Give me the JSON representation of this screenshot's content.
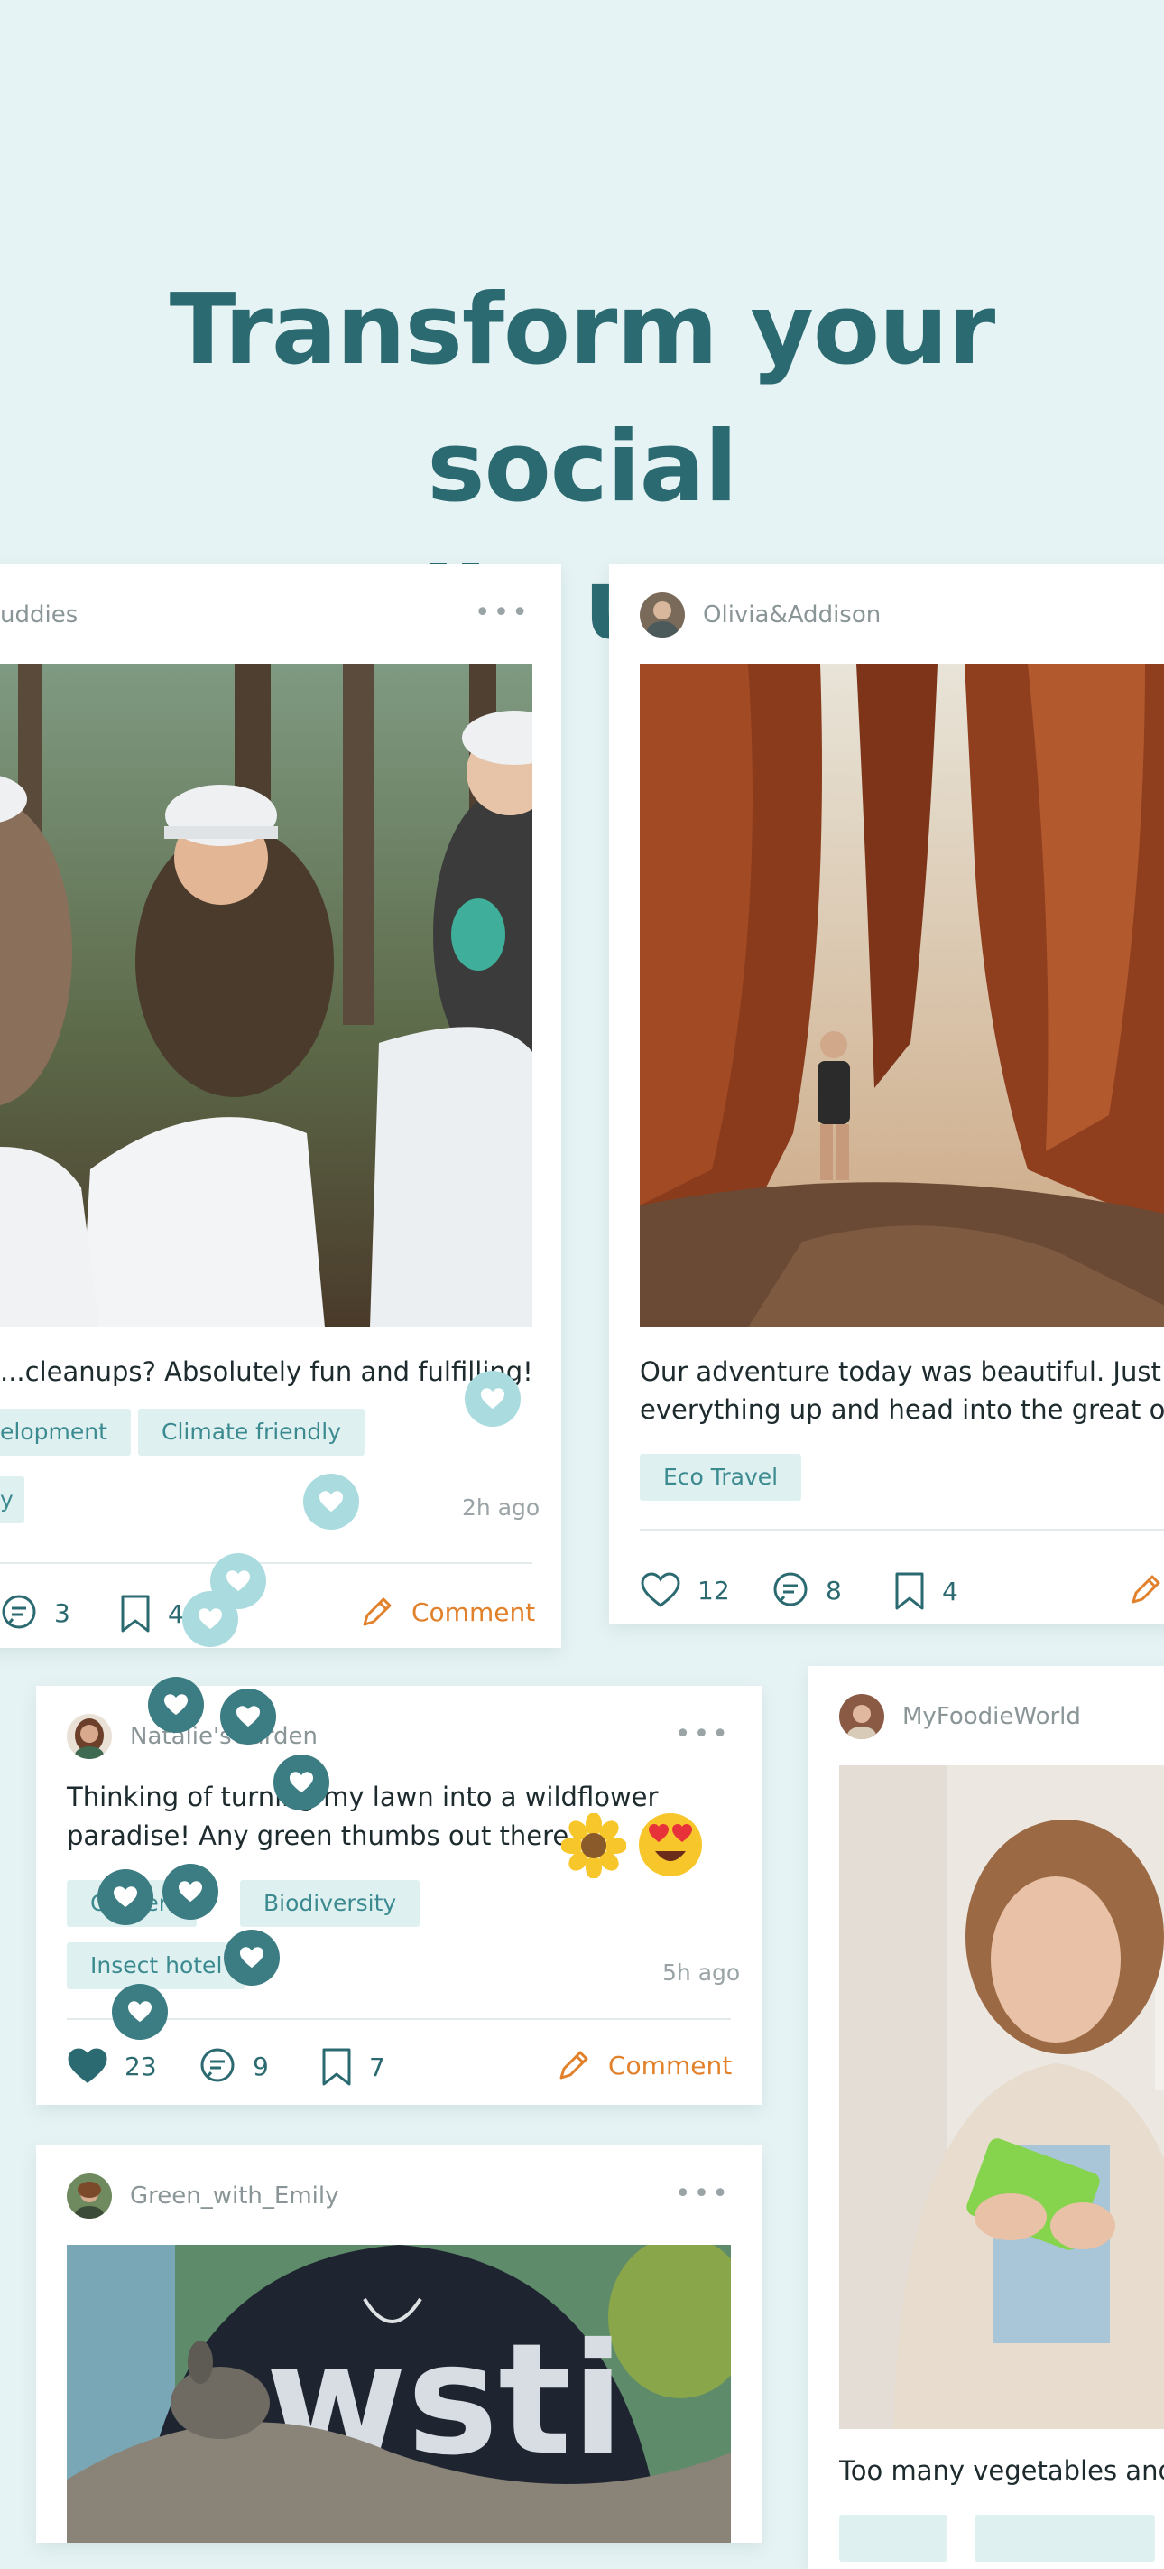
{
  "headline": {
    "line1": "Transform your social",
    "line2": "media usage."
  },
  "colors": {
    "teal": "#2b6a70",
    "accent": "#e2812b",
    "tag_bg": "#dff0f1",
    "background": "#e6f3f4"
  },
  "posts": {
    "cleanup": {
      "username": "uddies",
      "caption": "...cleanups? Absolutely fun and fulfilling!",
      "tags": [
        "elopment",
        "Climate friendly",
        "y"
      ],
      "time": "2h ago",
      "comments": "3",
      "saves": "4",
      "comment_label": "Comment",
      "image": "volunteers-cleanup-photo"
    },
    "adventure": {
      "username": "Olivia&Addison",
      "caption_line1": "Our adventure today was beautiful. Just pa",
      "caption_line2": "everything up and head into the great outd",
      "tags": [
        "Eco Travel"
      ],
      "likes": "12",
      "comments": "8",
      "saves": "4",
      "image": "redwood-forest-hiker-photo"
    },
    "wildflower": {
      "username": "Natalie'sGarden",
      "caption_line1": "Thinking of turning my lawn into a wildflower",
      "caption_line2": "paradise! Any green thumbs out there?",
      "emojis": [
        "sunflower",
        "heart-eyes"
      ],
      "tags": [
        "Garden",
        "Biodiversity",
        "Insect hotel"
      ],
      "time": "5h ago",
      "likes": "23",
      "comments": "9",
      "saves": "7",
      "comment_label": "Comment"
    },
    "foodie": {
      "username": "MyFoodieWorld",
      "caption": "Too many vegetables and...",
      "image": "woman-with-phone-photo"
    },
    "emily": {
      "username": "Green_with_Emily",
      "image": "kangaroo-rescue-photo"
    }
  }
}
